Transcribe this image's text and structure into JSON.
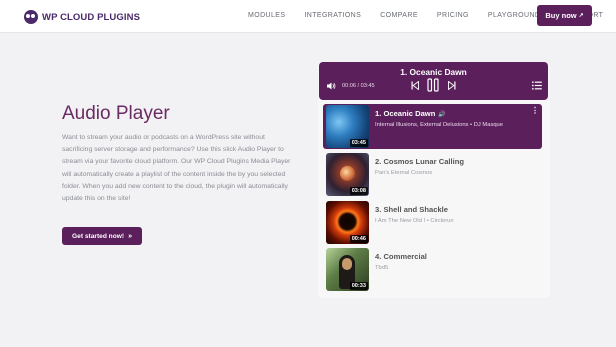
{
  "header": {
    "logo_text": "WP CLOUD PLUGINS",
    "nav": [
      {
        "label": "MODULES"
      },
      {
        "label": "INTEGRATIONS"
      },
      {
        "label": "COMPARE"
      },
      {
        "label": "PRICING"
      },
      {
        "label": "PLAYGROUND",
        "external": "↗"
      },
      {
        "label": "SUPPORT"
      }
    ],
    "buy_label": "Buy now",
    "buy_icon": "↗"
  },
  "main": {
    "title": "Audio Player",
    "description": "Want to stream your audio or podcasts on a WordPress site without sacrificing server storage and performance? Use this slick Audio Player to stream via your favorite cloud platform. Our WP Cloud Plugins Media Player will automatically create a playlist of the content inside the by you selected folder. When you add new content to the cloud, the plugin will automatically update this on the site!",
    "cta_label": "Get started now!",
    "cta_icon": "»"
  },
  "player": {
    "now_playing": "1. Oceanic Dawn",
    "time": "00:06 / 03:45",
    "icons": [
      "volume-icon",
      "previous-icon",
      "pause-icon",
      "next-icon",
      "playlist-icon"
    ],
    "tracks": [
      {
        "title": "1. Oceanic Dawn",
        "subtitle": "Internal Illusions, External Delusions • DJ Masque",
        "duration": "03:45",
        "active": true,
        "speaker": "🔊",
        "more": "⋮"
      },
      {
        "title": "2. Cosmos Lunar Calling",
        "subtitle": "Pan's Eternal Cosmos",
        "duration": "03:08",
        "active": false
      },
      {
        "title": "3. Shell and Shackle",
        "subtitle": "I Am The New Old I • Circlerun",
        "duration": "00:46",
        "active": false
      },
      {
        "title": "4. Commercial",
        "subtitle": "Tbd5",
        "duration": "00:33",
        "active": false
      }
    ]
  },
  "colors": {
    "brand": "#5b1f5c",
    "title": "#6a2a63",
    "background": "#f2f2f4"
  }
}
